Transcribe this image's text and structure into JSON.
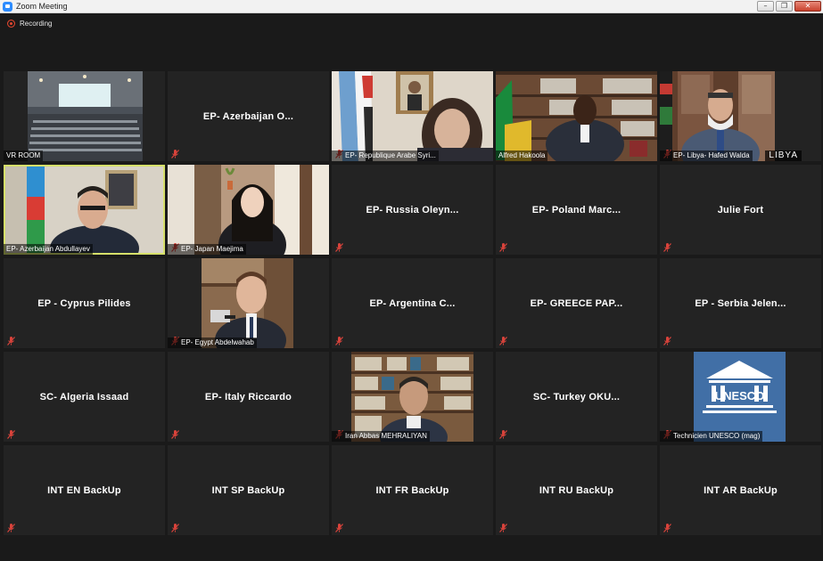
{
  "window": {
    "title": "Zoom Meeting",
    "controls": {
      "minimize": "–",
      "restore": "❐",
      "close": "✕"
    }
  },
  "recording": {
    "label": "Recording",
    "color": "#e2462f"
  },
  "accent": {
    "active_speaker_outline": "#d6e06a",
    "mic_muted": "#d9433b"
  },
  "participants": [
    {
      "name": "VR ROOM",
      "video": true,
      "muted": false
    },
    {
      "name": "EP- Azerbaijan O...",
      "video": false,
      "muted": true
    },
    {
      "name": "EP- Republique Arabe Syri...",
      "video": true,
      "muted": true
    },
    {
      "name": "Alfred Hakoola",
      "video": true,
      "muted": false
    },
    {
      "name": "EP- Libya- Hafed Walda",
      "video": true,
      "muted": true,
      "badge": "LIBYA"
    },
    {
      "name": "EP- Azerbaijan Abdullayev",
      "video": true,
      "muted": false,
      "active": true
    },
    {
      "name": "EP- Japan Maejima",
      "video": true,
      "muted": true
    },
    {
      "name": "EP- Russia Oleyn...",
      "video": false,
      "muted": true
    },
    {
      "name": "EP- Poland Marc...",
      "video": false,
      "muted": true
    },
    {
      "name": "Julie Fort",
      "video": false,
      "muted": true
    },
    {
      "name": "EP - Cyprus Pilides",
      "video": false,
      "muted": true
    },
    {
      "name": "EP- Egypt Abdelwahab",
      "video": true,
      "muted": true
    },
    {
      "name": "EP- Argentina C...",
      "video": false,
      "muted": true
    },
    {
      "name": "EP- GREECE PAP...",
      "video": false,
      "muted": true
    },
    {
      "name": "EP - Serbia Jelen...",
      "video": false,
      "muted": true
    },
    {
      "name": "SC- Algeria Issaad",
      "video": false,
      "muted": true
    },
    {
      "name": "EP- Italy Riccardo",
      "video": false,
      "muted": true
    },
    {
      "name": "Iran Abbas MEHRALIYAN",
      "video": true,
      "muted": true
    },
    {
      "name": "SC- Turkey OKU...",
      "video": false,
      "muted": true
    },
    {
      "name": "Technicien UNESCO (mag)",
      "video": true,
      "muted": true,
      "logo_text": "UNESCO"
    },
    {
      "name": "INT EN BackUp",
      "video": false,
      "muted": true
    },
    {
      "name": "INT SP BackUp",
      "video": false,
      "muted": true
    },
    {
      "name": "INT FR BackUp",
      "video": false,
      "muted": true
    },
    {
      "name": "INT RU BackUp",
      "video": false,
      "muted": true
    },
    {
      "name": "INT AR BackUp",
      "video": false,
      "muted": true
    }
  ]
}
